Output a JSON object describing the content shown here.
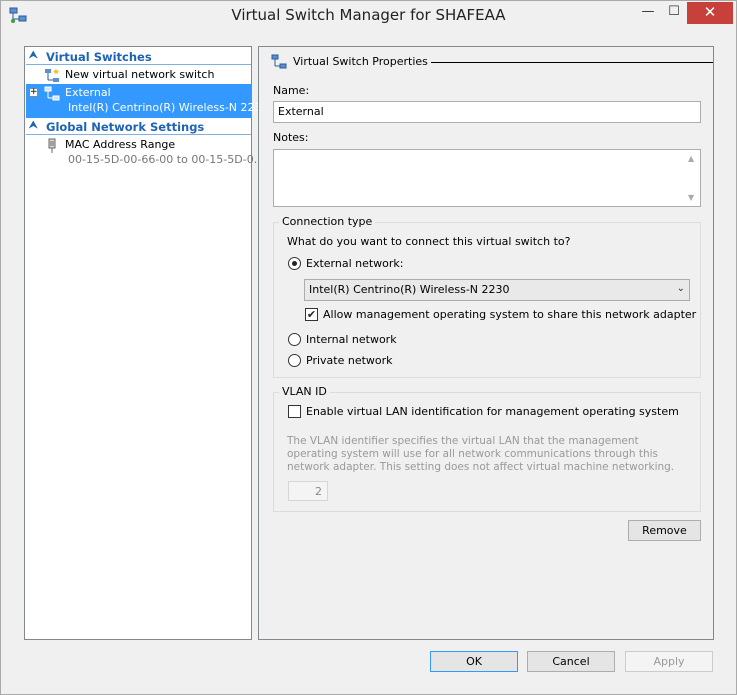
{
  "window": {
    "title": "Virtual Switch Manager for SHAFEAA"
  },
  "titlebar": {
    "min_glyph": "—",
    "max_glyph": "☐",
    "close_glyph": "✕"
  },
  "sidebar": {
    "virtual_switches_header": "Virtual Switches",
    "new_switch_label": "New virtual network switch",
    "external_label": "External",
    "external_adapter": "Intel(R) Centrino(R) Wireless-N 2230",
    "global_header": "Global Network Settings",
    "mac_label": "MAC Address Range",
    "mac_value": "00-15-5D-00-66-00 to 00-15-5D-0..."
  },
  "properties": {
    "header": "Virtual Switch Properties",
    "name_label": "Name:",
    "name_value": "External",
    "notes_label": "Notes:",
    "notes_value": ""
  },
  "connection": {
    "group_title": "Connection type",
    "question": "What do you want to connect this virtual switch to?",
    "external_label": "External network:",
    "adapter_selected": "Intel(R) Centrino(R) Wireless-N 2230",
    "allow_mgmt_label": "Allow management operating system to share this network adapter",
    "internal_label": "Internal network",
    "private_label": "Private network",
    "selected_type": "external",
    "allow_mgmt_checked": true
  },
  "vlan": {
    "group_title": "VLAN ID",
    "enable_label": "Enable virtual LAN identification for management operating system",
    "enable_checked": false,
    "description": "The VLAN identifier specifies the virtual LAN that the management operating system will use for all network communications through this network adapter. This setting does not affect virtual machine networking.",
    "vlan_value": "2"
  },
  "buttons": {
    "remove": "Remove",
    "ok": "OK",
    "cancel": "Cancel",
    "apply": "Apply"
  },
  "colors": {
    "accent": "#3399ff",
    "header_text": "#1e64b4",
    "close_button": "#c7413a"
  }
}
